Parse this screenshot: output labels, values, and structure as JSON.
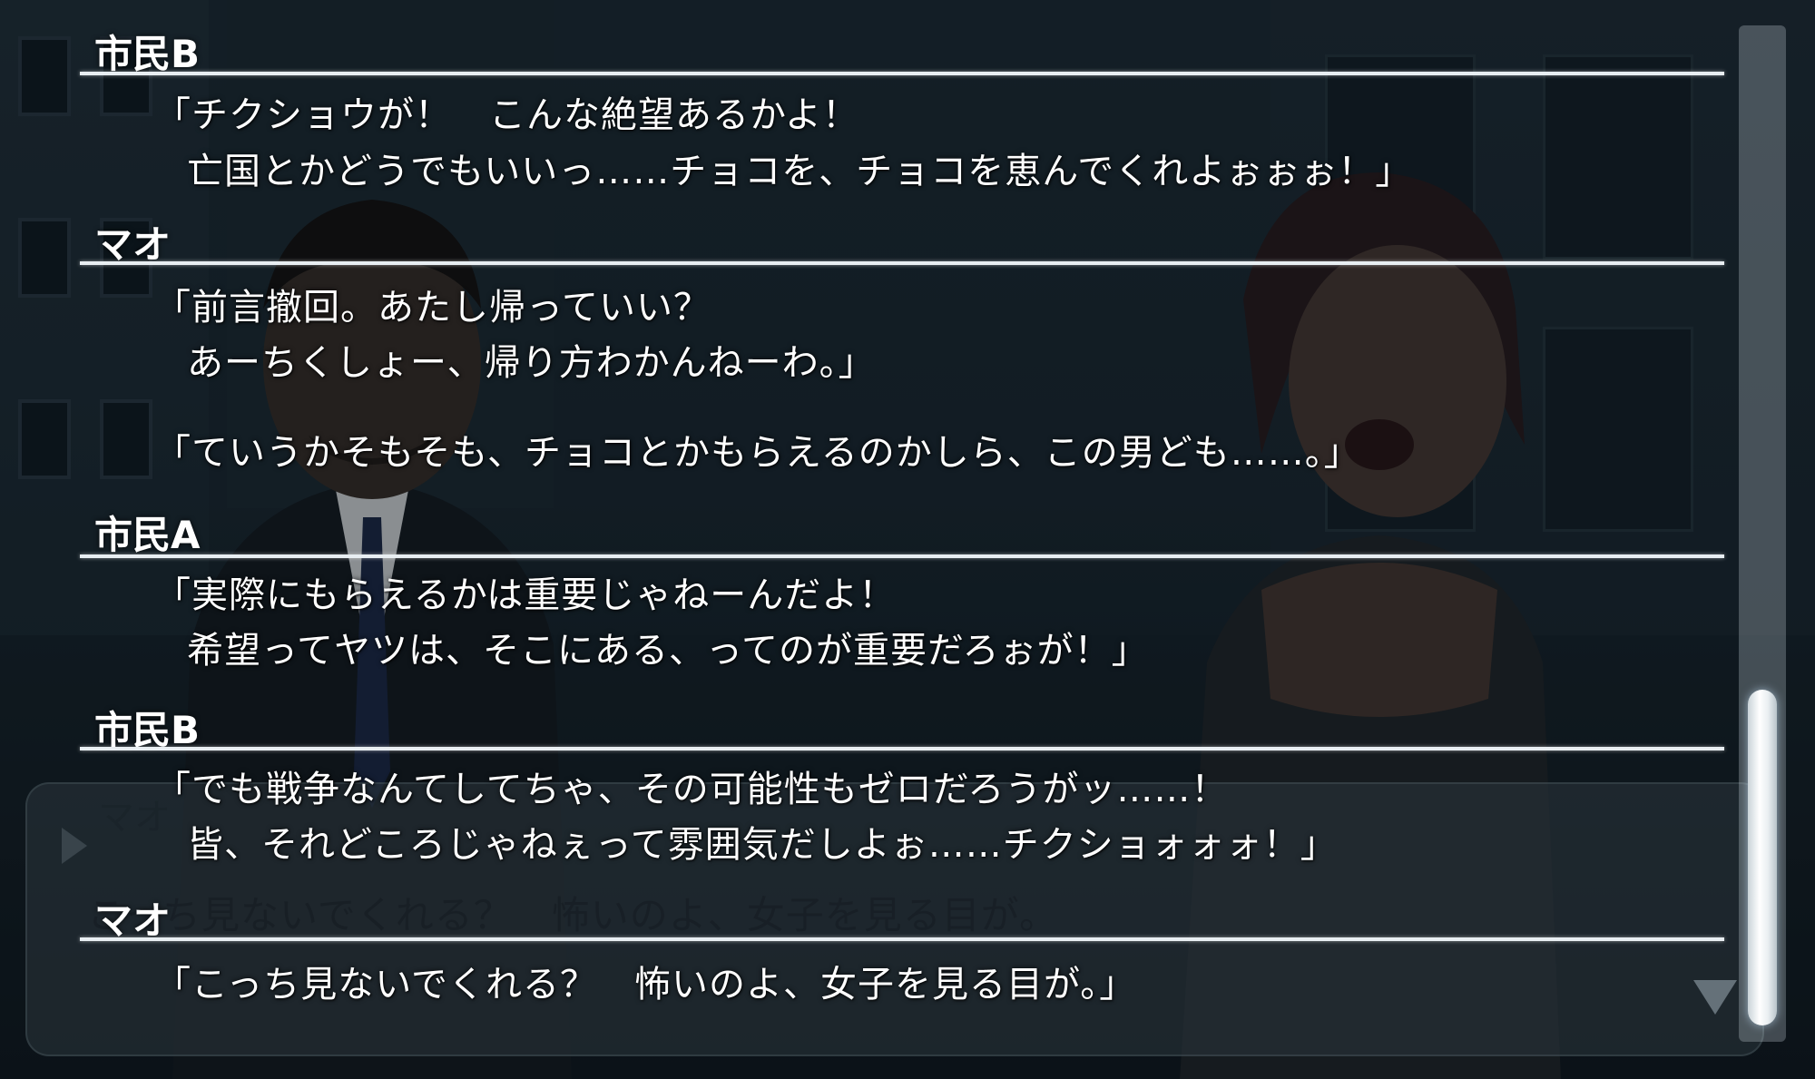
{
  "entries": [
    {
      "speaker": "市民B",
      "lines": [
        "「チクショウが！　こんな絶望あるかよ！",
        "亡国とかどうでもいいっ……チョコを、チョコを恵んでくれよぉぉぉ！」"
      ]
    },
    {
      "speaker": "マオ",
      "lines": [
        "「前言撤回。あたし帰っていい？",
        "あーちくしょー、帰り方わかんねーわ。」",
        "「ていうかそもそも、チョコとかもらえるのかしら、この男ども……。」"
      ]
    },
    {
      "speaker": "市民A",
      "lines": [
        "「実際にもらえるかは重要じゃねーんだよ！",
        "希望ってヤツは、そこにある、ってのが重要だろぉが！」"
      ]
    },
    {
      "speaker": "市民B",
      "lines": [
        "「でも戦争なんてしてちゃ、その可能性もゼロだろうがッ……！",
        "皆、それどころじゃねぇって雰囲気だしよぉ……チクショォォォ！」"
      ]
    },
    {
      "speaker": "マオ",
      "lines": [
        "「こっち見ないでくれる？　怖いのよ、女子を見る目が。」"
      ]
    }
  ],
  "message_window": {
    "speaker": "マオ",
    "text": "こっち見ないでくれる？　怖いのよ、女子を見る目が。"
  },
  "scrollbar": {
    "position": 0.86
  },
  "icons": {
    "next": "down-triangle-icon",
    "page": "left-triangle-icon"
  }
}
